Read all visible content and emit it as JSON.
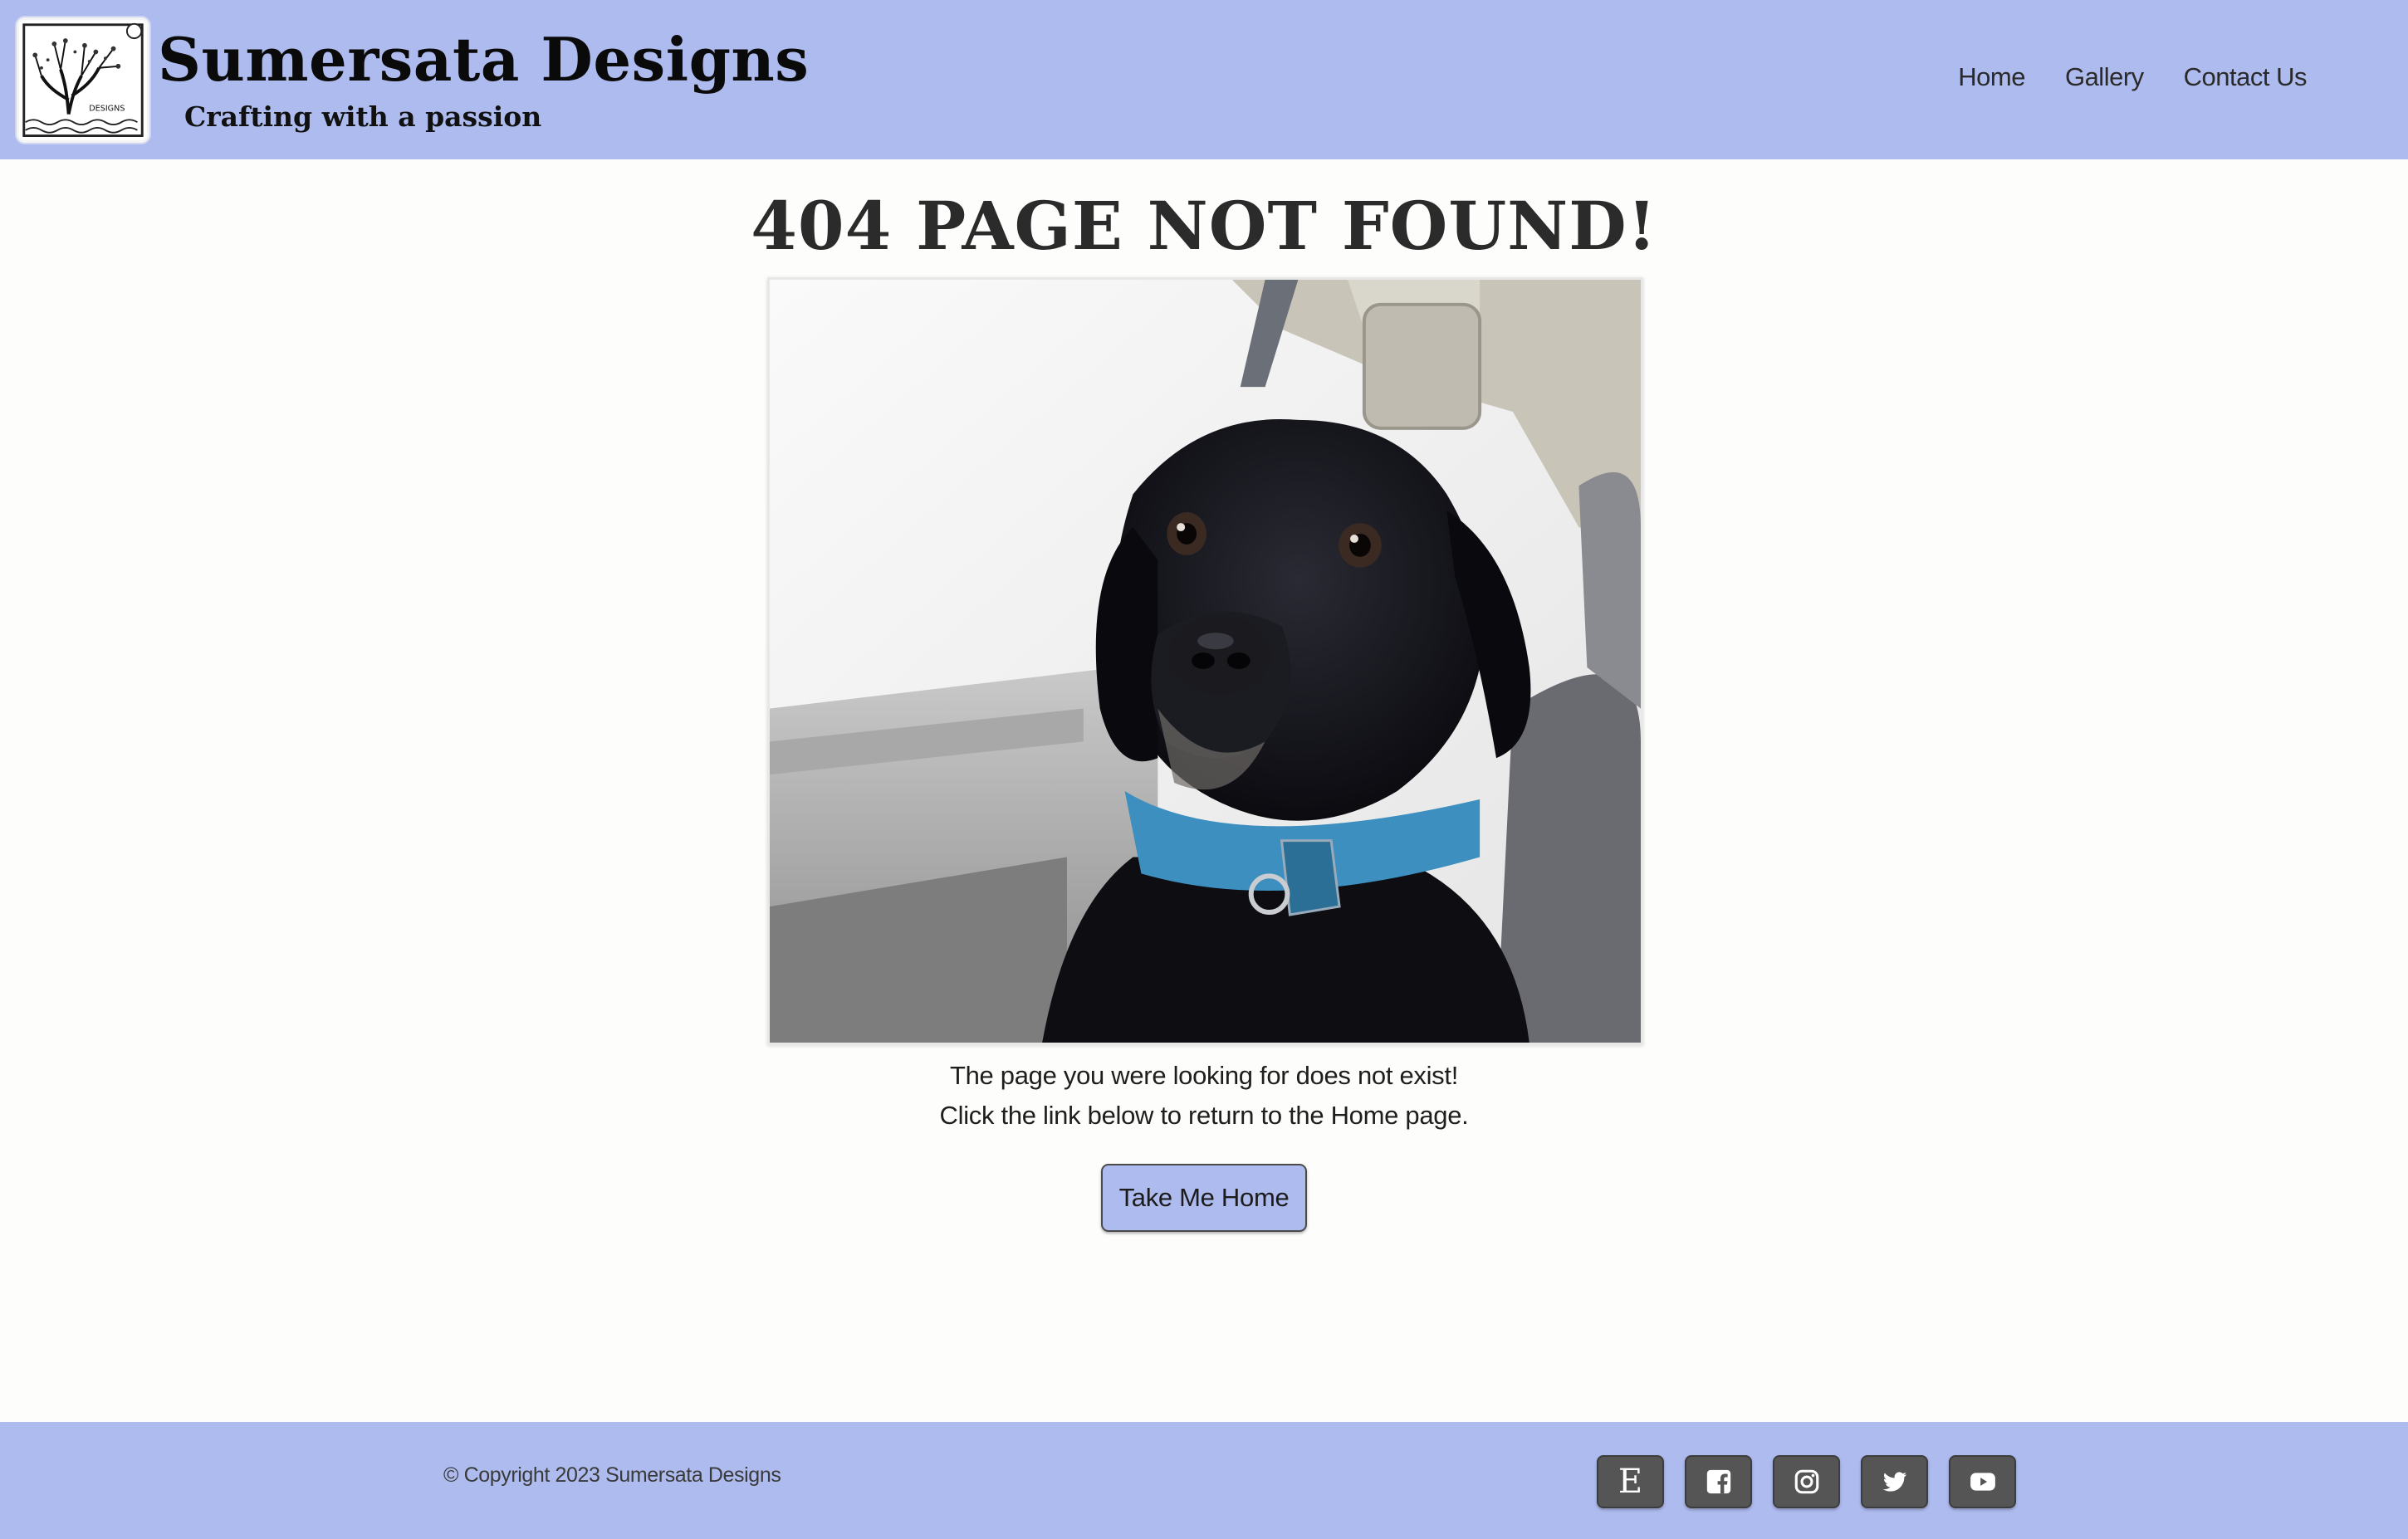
{
  "header": {
    "brand_name": "Sumersata Designs",
    "tagline": "Crafting with a passion",
    "logo_text": "DESIGNS",
    "nav": [
      {
        "label": "Home"
      },
      {
        "label": "Gallery"
      },
      {
        "label": "Contact Us"
      }
    ]
  },
  "main": {
    "title": "404 PAGE NOT FOUND!",
    "image_subject": "black-dog-in-car-photo",
    "message_line_1": "The page you were looking for does not exist!",
    "message_line_2": "Click the link below to return to the Home page.",
    "button_label": "Take Me Home"
  },
  "footer": {
    "copyright": "© Copyright 2023 Sumersata Designs",
    "social": [
      {
        "name": "etsy-icon",
        "glyph": "E"
      },
      {
        "name": "facebook-icon"
      },
      {
        "name": "instagram-icon"
      },
      {
        "name": "twitter-icon"
      },
      {
        "name": "youtube-icon"
      }
    ]
  },
  "colors": {
    "accent": "#aebbee",
    "page_background": "#fdfdfb",
    "social_button": "#555555",
    "text": "#222222"
  }
}
